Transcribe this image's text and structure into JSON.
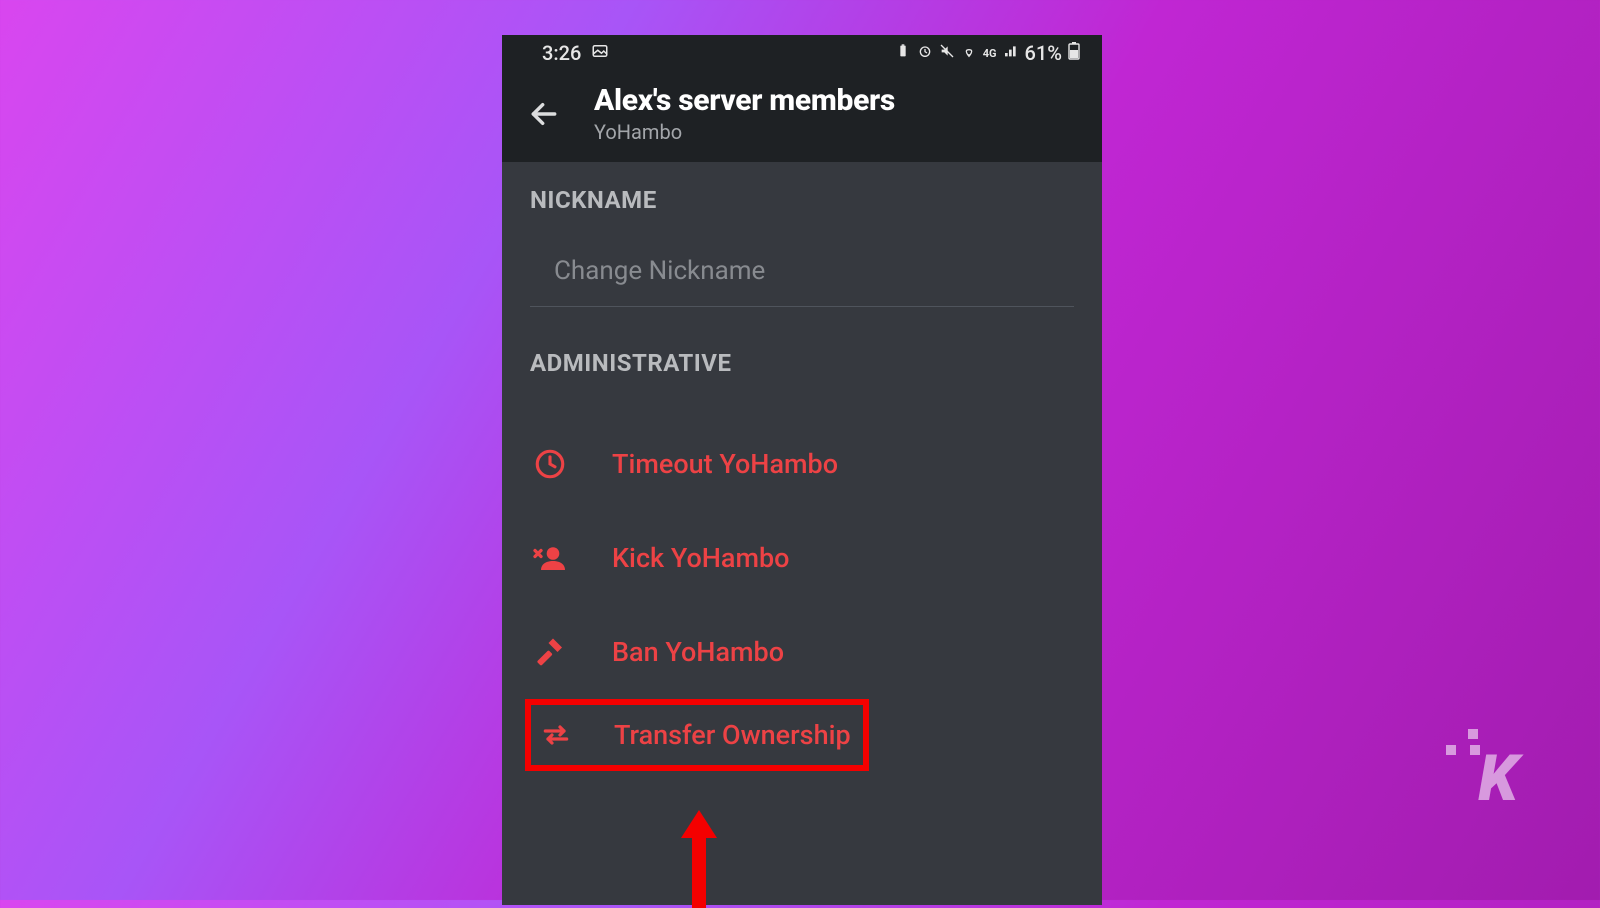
{
  "status_bar": {
    "time": "3:26",
    "battery_text": "61%"
  },
  "header": {
    "title": "Alex's server members",
    "subtitle": "YoHambo"
  },
  "sections": {
    "nickname_label": "NICKNAME",
    "nickname_placeholder": "Change Nickname",
    "administrative_label": "ADMINISTRATIVE"
  },
  "admin_actions": {
    "timeout": "Timeout YoHambo",
    "kick": "Kick YoHambo",
    "ban": "Ban YoHambo",
    "transfer": "Transfer Ownership"
  },
  "colors": {
    "danger": "#ed4245",
    "highlight": "#f40000"
  },
  "watermark": "K"
}
